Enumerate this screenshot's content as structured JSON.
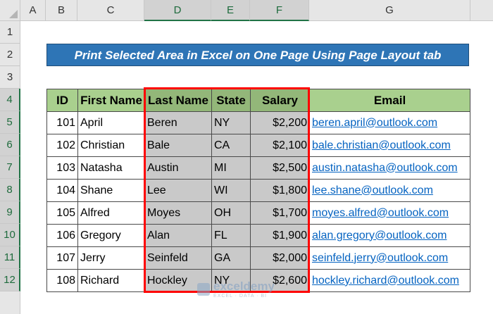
{
  "columns": [
    "A",
    "B",
    "C",
    "D",
    "E",
    "F",
    "G"
  ],
  "rows": [
    "1",
    "2",
    "3",
    "4",
    "5",
    "6",
    "7",
    "8",
    "9",
    "10",
    "11",
    "12"
  ],
  "title": "Print Selected Area in Excel on One Page Using Page Layout tab",
  "table": {
    "headers": {
      "id": "ID",
      "first": "First Name",
      "last": "Last Name",
      "state": "State",
      "salary": "Salary",
      "email": "Email"
    },
    "rows": [
      {
        "id": "101",
        "first": "April",
        "last": "Beren",
        "state": "NY",
        "salary": "$2,200",
        "email": "beren.april@outlook.com"
      },
      {
        "id": "102",
        "first": "Christian",
        "last": "Bale",
        "state": "CA",
        "salary": "$2,100",
        "email": "bale.christian@outlook.com"
      },
      {
        "id": "103",
        "first": "Natasha",
        "last": "Austin",
        "state": "MI",
        "salary": "$2,500",
        "email": "austin.natasha@outlook.com"
      },
      {
        "id": "104",
        "first": "Shane",
        "last": "Lee",
        "state": "WI",
        "salary": "$1,800",
        "email": "lee.shane@outlook.com"
      },
      {
        "id": "105",
        "first": "Alfred",
        "last": "Moyes",
        "state": "OH",
        "salary": "$1,700",
        "email": "moyes.alfred@outlook.com"
      },
      {
        "id": "106",
        "first": "Gregory",
        "last": "Alan",
        "state": "FL",
        "salary": "$1,900",
        "email": "alan.gregory@outlook.com"
      },
      {
        "id": "107",
        "first": "Jerry",
        "last": "Seinfeld",
        "state": "GA",
        "salary": "$2,000",
        "email": "seinfeld.jerry@outlook.com"
      },
      {
        "id": "108",
        "first": "Richard",
        "last": "Hockley",
        "state": "NY",
        "salary": "$2,600",
        "email": "hockley.richard@outlook.com"
      }
    ]
  },
  "watermark": {
    "name": "exceldemy",
    "tagline": "EXCEL · DATA · BI"
  },
  "colors": {
    "title_bg": "#2e75b6",
    "header_bg": "#a9d08e",
    "selection_bg": "#c9c9c9",
    "selection_border": "#ff0000",
    "link": "#0563c1"
  }
}
